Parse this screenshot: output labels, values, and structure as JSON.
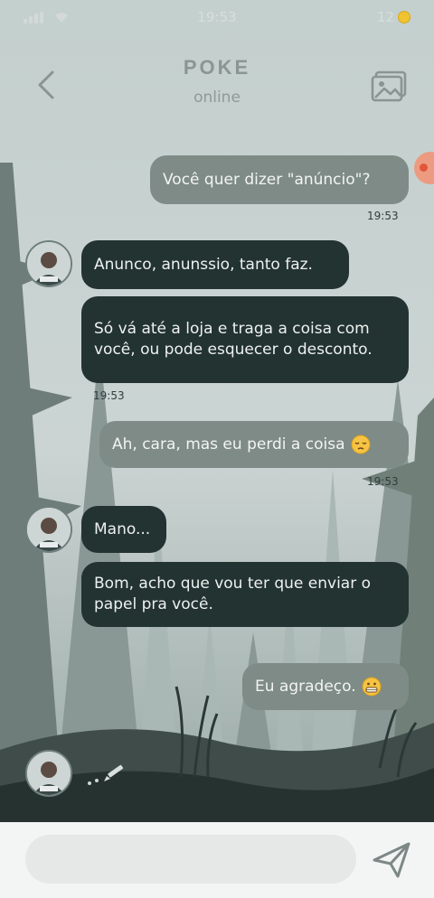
{
  "status_bar": {
    "time": "19:53",
    "notification_count": "12"
  },
  "header": {
    "name": "POKE",
    "status": "online"
  },
  "messages": [
    {
      "dir": "sent",
      "text": "Você quer dizer \"anúncio\"?",
      "time": "19:53"
    },
    {
      "dir": "recv",
      "text": "Anunco, anunssio, tanto faz."
    },
    {
      "dir": "recv",
      "text": "Só vá até a loja e traga a coisa com você, ou pode esquecer o desconto.",
      "time": "19:53"
    },
    {
      "dir": "sent",
      "text": "Ah, cara, mas eu perdi a coisa",
      "emoji": "pensive-face",
      "time": "19:53"
    },
    {
      "dir": "recv",
      "text": "Mano..."
    },
    {
      "dir": "recv",
      "text": "Bom, acho que vou ter que enviar o papel pra você."
    },
    {
      "dir": "sent",
      "text": "Eu agradeço.",
      "emoji": "grimacing-face"
    }
  ],
  "composer": {
    "placeholder": ""
  },
  "icons": {
    "back": "chevron-left-icon",
    "gallery": "gallery-icon",
    "send": "paper-plane-icon",
    "typing": "pencil-icon"
  },
  "colors": {
    "sent_bubble": "#7f8b86",
    "received_bubble": "#223331",
    "accent": "#e2553a"
  }
}
